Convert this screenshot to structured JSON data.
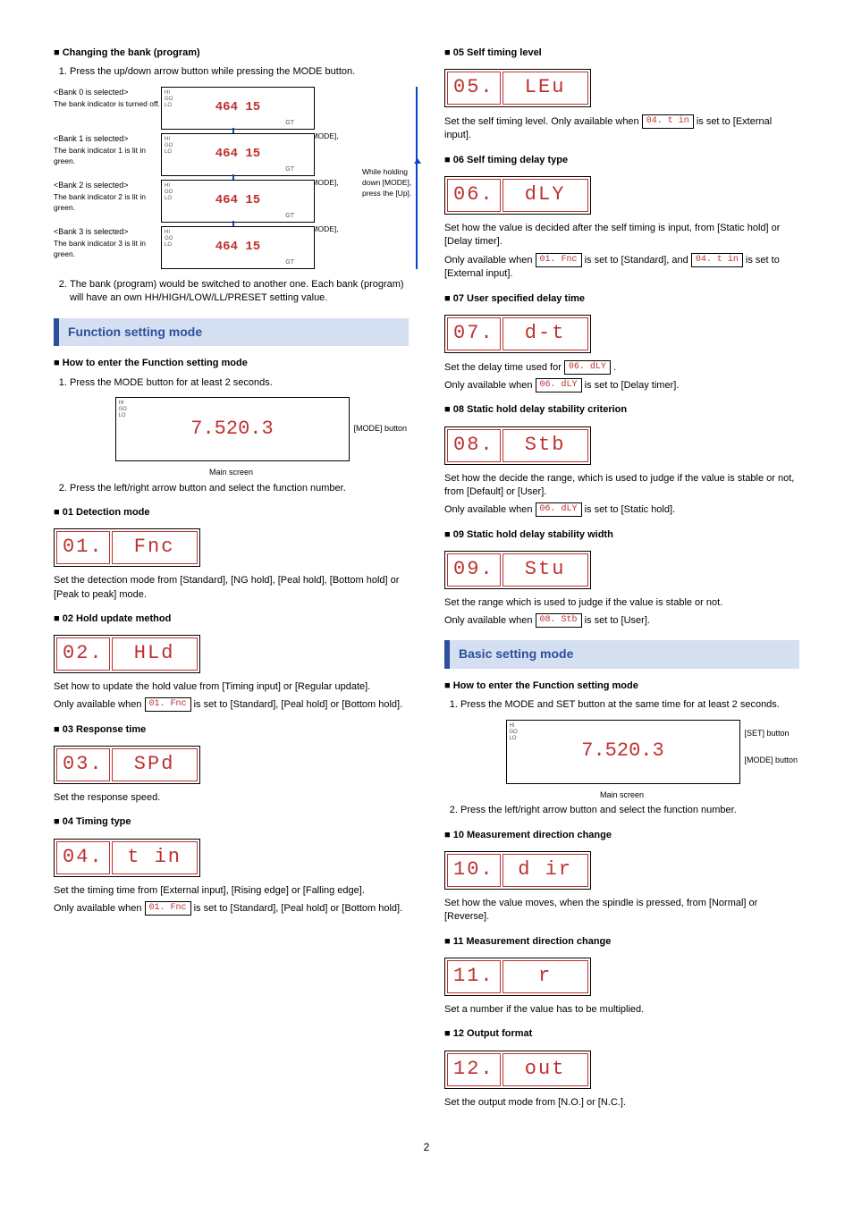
{
  "left": {
    "changing_bank": {
      "title": "Changing the bank (program)",
      "step1": "Press the up/down arrow button while pressing the MODE button.",
      "rows": [
        {
          "sel": "<Bank 0 is selected>",
          "note": "The bank indicator is turned off.",
          "hold": "While holding down [MODE], press [Up]."
        },
        {
          "sel": "<Bank 1 is selected>",
          "note": "The bank indicator 1 is lit in green.",
          "hold": "While holding down [MODE], press [Up]."
        },
        {
          "sel": "<Bank 2 is selected>",
          "note": "The bank indicator 2 is lit in green.",
          "hold": "While holding down [MODE], press [Up]."
        },
        {
          "sel": "<Bank 3 is selected>",
          "note": "The bank indicator 3 is lit in green.",
          "hold": ""
        }
      ],
      "return_arrow": "While holding down [MODE], press the [Up].",
      "device_value": "464 15",
      "step2": "The bank (program) would be switched to another one. Each bank (program) will have an own HH/HIGH/LOW/LL/PRESET setting value."
    },
    "function_mode": {
      "banner": "Function setting mode",
      "howto_title": "How to enter the Function setting mode",
      "step1": "Press the MODE button for at least 2 seconds.",
      "device_value": "7.520.3",
      "device_annot": "[MODE] button",
      "main_screen": "Main screen",
      "step2": "Press the left/right arrow button and select the function number."
    },
    "f01": {
      "title": "01 Detection mode",
      "num": "01.",
      "code": "Fnc",
      "desc": "Set the detection mode from [Standard], [NG hold], [Peal hold], [Bottom hold] or [Peak to peak] mode."
    },
    "f02": {
      "title": "02 Hold update method",
      "num": "02.",
      "code": "HLd",
      "desc": "Set how to update the hold value from [Timing input] or [Regular update].",
      "avail": "Only available when ",
      "ref": "01. Fnc",
      "avail2": " is set to [Standard], [Peal hold] or [Bottom hold]."
    },
    "f03": {
      "title": "03 Response time",
      "num": "03.",
      "code": "SPd",
      "desc": "Set the response speed."
    },
    "f04": {
      "title": "04 Timing type",
      "num": "04.",
      "code": "t in",
      "desc": "Set the timing time from [External input], [Rising edge] or [Falling edge].",
      "avail": "Only available when ",
      "ref": "01. Fnc",
      "avail2": " is set to [Standard], [Peal hold] or [Bottom hold]."
    }
  },
  "right": {
    "f05": {
      "title": "05 Self timing level",
      "num": "05.",
      "code": "LEu",
      "desc1": "Set the self timing level. Only available when ",
      "ref": "04. t in",
      "desc2": " is set to [External input]."
    },
    "f06": {
      "title": "06 Self timing delay type",
      "num": "06.",
      "code": "dLY",
      "desc": "Set how the value is decided after the self timing is input, from [Static hold] or [Delay timer].",
      "avail": "Only available when ",
      "ref1": "01. Fnc",
      "mid": " is set to [Standard], and ",
      "ref2": "04. t in",
      "avail2": " is set to [External input]."
    },
    "f07": {
      "title": "07 User specified delay time",
      "num": "07.",
      "code": "d-t",
      "desc1": "Set the delay time used for ",
      "ref1": "06. dLY",
      "desc1b": ".",
      "avail": "Only available when ",
      "ref2": "06. dLY",
      "avail2": " is set to [Delay timer]."
    },
    "f08": {
      "title": "08 Static hold delay stability criterion",
      "num": "08.",
      "code": "Stb",
      "desc": "Set how the decide the range, which is used to judge if the value is stable or not, from [Default] or [User].",
      "avail": "Only available when ",
      "ref": "06. dLY",
      "avail2": " is set to [Static hold]."
    },
    "f09": {
      "title": "09 Static hold delay stability width",
      "num": "09.",
      "code": "Stu",
      "desc": "Set the range which is used to judge if the value is stable or not.",
      "avail": "Only available when ",
      "ref": "08. Stb",
      "avail2": " is set to [User]."
    },
    "basic_mode": {
      "banner": "Basic setting mode",
      "howto_title": "How to enter the Function setting mode",
      "step1": "Press the MODE and SET button at the same time for at least 2 seconds.",
      "device_value": "7.520.3",
      "annot_set": "[SET] button",
      "annot_mode": "[MODE] button",
      "main_screen": "Main screen",
      "step2": "Press the left/right arrow button and select the function number."
    },
    "f10": {
      "title": "10 Measurement direction change",
      "num": "10.",
      "code": "d ir",
      "desc": "Set how the value moves, when the spindle is pressed, from [Normal] or [Reverse]."
    },
    "f11": {
      "title": "11 Measurement direction change",
      "num": "11.",
      "code": "r",
      "desc": "Set a number if the value has to be multiplied."
    },
    "f12": {
      "title": "12 Output format",
      "num": "12.",
      "code": "out",
      "desc": "Set the output mode from [N.O.] or [N.C.]."
    }
  },
  "page_number": "2"
}
